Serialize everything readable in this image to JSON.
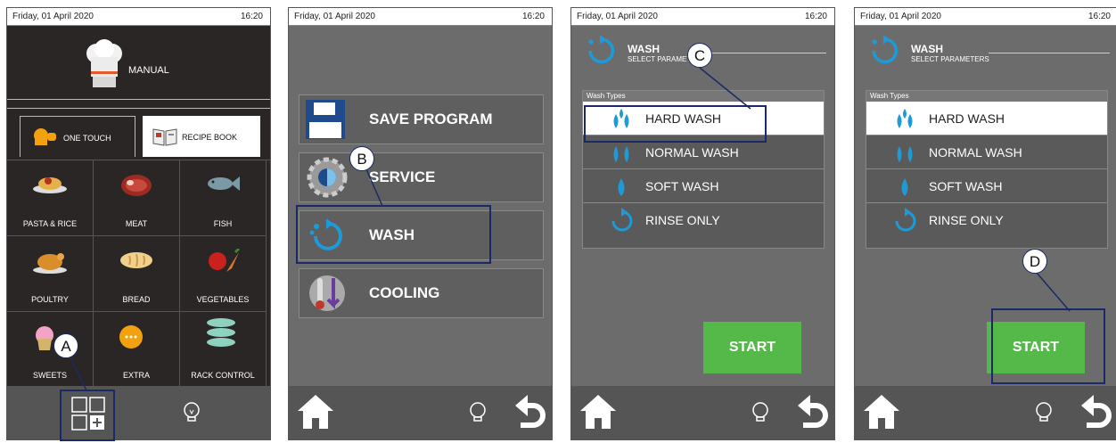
{
  "status": {
    "date": "Friday, 01 April 2020",
    "time": "16:20"
  },
  "screen1": {
    "manual_label": "MANUAL",
    "tabs": {
      "one_touch": "ONE TOUCH",
      "recipe_book": "RECIPE BOOK"
    },
    "categories": [
      "PASTA & RICE",
      "MEAT",
      "FISH",
      "POULTRY",
      "BREAD",
      "VEGETABLES",
      "SWEETS",
      "EXTRA",
      "RACK CONTROL"
    ],
    "callout": "A"
  },
  "screen2": {
    "menu": [
      "SAVE PROGRAM",
      "SERVICE",
      "WASH",
      "COOLING"
    ],
    "callout": "B"
  },
  "wash": {
    "title": "WASH",
    "subtitle": "SELECT PARAMETERS",
    "types_header": "Wash Types",
    "types": [
      "HARD WASH",
      "NORMAL WASH",
      "SOFT WASH",
      "RINSE ONLY"
    ],
    "start": "START"
  },
  "callouts": {
    "c": "C",
    "d": "D"
  },
  "colors": {
    "accent_blue": "#1e9ad6",
    "start_green": "#55b94a",
    "callout_border": "#1b2a66"
  }
}
